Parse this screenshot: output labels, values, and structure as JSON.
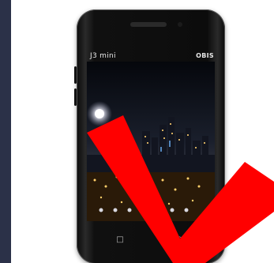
{
  "phone": {
    "model_label": "J3 mini",
    "brand_logo": "OBIS",
    "screen_wallpaper": "night-city-skyline",
    "nav_keys": {
      "back_icon": "square-icon",
      "home_icon": "circle-icon"
    },
    "nav_glyphs": {
      "back": "□",
      "home": "○"
    }
  },
  "overlay": {
    "mark": "red-checkmark",
    "color": "#ff0000"
  },
  "colors": {
    "page_background": "#262d44",
    "phone_body": "#0b0b0b",
    "check_mark": "#ff0000"
  }
}
